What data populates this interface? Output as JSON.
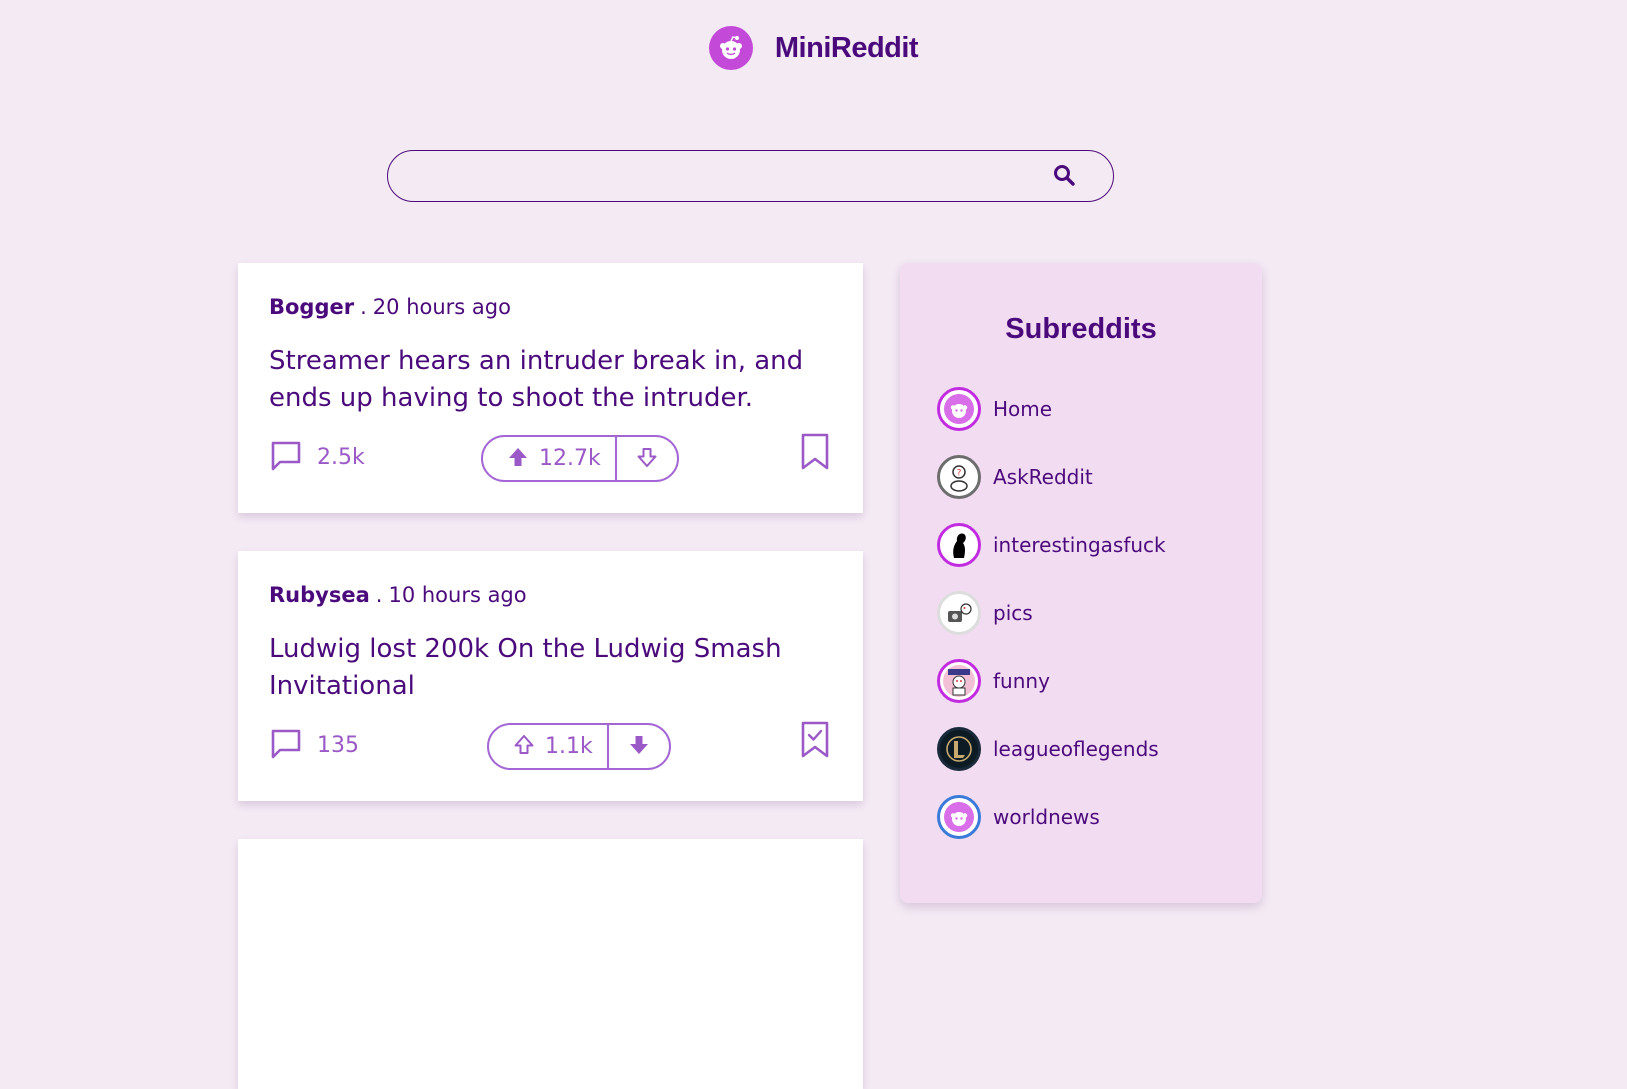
{
  "app": {
    "title": "MiniReddit",
    "logo_icon": "reddit-alien-icon"
  },
  "search": {
    "value": "",
    "placeholder": "",
    "icon": "search-icon"
  },
  "posts": [
    {
      "author": "Bogger",
      "separator": ".",
      "time": "20 hours ago",
      "title": "Streamer hears an intruder break in, and ends up having to shoot the intruder.",
      "comments": "2.5k",
      "votes": "12.7k",
      "upvoted": true,
      "downvoted": false,
      "saved": false
    },
    {
      "author": "Rubysea",
      "separator": ".",
      "time": "10 hours ago",
      "title": "Ludwig lost 200k On the Ludwig Smash Invitational",
      "comments": "135",
      "votes": "1.1k",
      "upvoted": false,
      "downvoted": true,
      "saved": true
    }
  ],
  "sidebar": {
    "title": "Subreddits",
    "items": [
      {
        "label": "Home",
        "icon": "reddit-alien-icon",
        "ring": "#c22ce0"
      },
      {
        "label": "AskReddit",
        "icon": "askreddit-icon",
        "ring": "#6d6d6d"
      },
      {
        "label": "interestingasfuck",
        "icon": "silhouette-icon",
        "ring": "#c22ce0"
      },
      {
        "label": "pics",
        "icon": "pics-icon",
        "ring": "#dddddd"
      },
      {
        "label": "funny",
        "icon": "funny-icon",
        "ring": "#c22ce0"
      },
      {
        "label": "leagueoflegends",
        "icon": "league-icon",
        "ring": "#1a2a3a"
      },
      {
        "label": "worldnews",
        "icon": "reddit-alien-icon",
        "ring": "#3a7ad8"
      }
    ]
  },
  "colors": {
    "background": "#f4eaf4",
    "primary": "#4b0a7c",
    "accent": "#9b59c7",
    "sidebar_bg": "#f2dcf2",
    "logo": "#c34ad8"
  }
}
